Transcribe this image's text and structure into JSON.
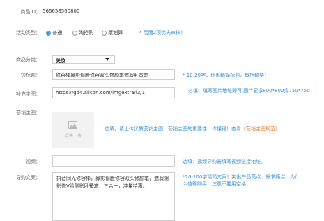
{
  "product_id": {
    "label": "商品ID：",
    "value": "566658560800"
  },
  "activity_type": {
    "label": "活动类型：",
    "options": [
      "普通",
      "淘抢购",
      "聚划算"
    ],
    "selected": 0,
    "note": "* 后面2项优先审核！"
  },
  "category": {
    "label": "商品分类：",
    "selected": "美妆"
  },
  "short_title": {
    "label": "短标题：",
    "value": "修容棒鼻影偷脸修容双头修颜笔遮瑕卧蚕笔",
    "hint": "* 10-20字，优惠精简标题，概括精华！"
  },
  "main_image": {
    "label": "补充主图：",
    "value": "https://gd4.alicdn.com/imgextra/i3/1",
    "hint": "必填：填写图片地址即可,图片要求800*800或750*750"
  },
  "marketing_image": {
    "label": "营销主图：",
    "upload_text": "点击上传",
    "hint": "选填，请上传优质营销主图，营销主图的重要性，你懂得！查看",
    "link": "《营销主图规范》"
  },
  "video": {
    "label": "视频：",
    "value": "",
    "hint": "选填：视频导购需填写视频链接地址。"
  },
  "copy": {
    "label": "导购文案：",
    "value": "抖音同光修容棒，鼻影偷脸修容双头修颜笔，遮瑕阴影修V脸侧影卧蚕笔，三合一，冲量特惠。",
    "hint": "*20-100字精简文案！突出产品亮点、需求痛点、为什么值得购买！注意不要用空格！"
  },
  "colors": {
    "accent": "#3a8fd6",
    "link_orange": "#e8742c"
  }
}
